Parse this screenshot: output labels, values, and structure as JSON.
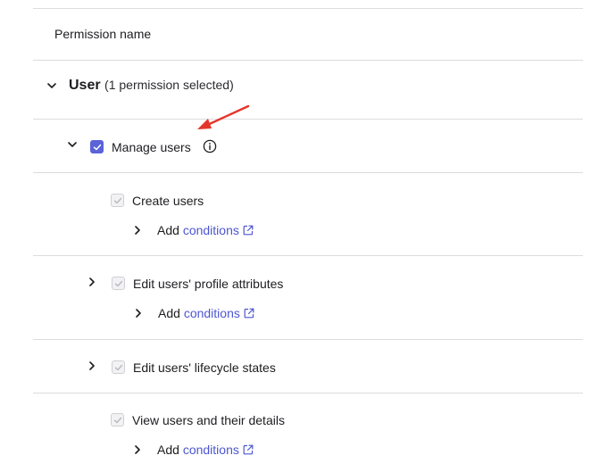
{
  "table": {
    "header": "Permission name"
  },
  "group": {
    "title": "User",
    "subtitle": "(1 permission selected)"
  },
  "parent_permission": {
    "label": "Manage users",
    "checked": true
  },
  "permissions": [
    {
      "label": "Create users",
      "add_text": "Add",
      "link_text": "conditions",
      "has_chevron": false
    },
    {
      "label": "Edit users' profile attributes",
      "add_text": "Add",
      "link_text": "conditions",
      "has_chevron": true
    },
    {
      "label": "Edit users' lifecycle states",
      "has_chevron": true
    },
    {
      "label": "View users and their details",
      "add_text": "Add",
      "link_text": "conditions",
      "has_chevron": false
    }
  ],
  "icons": {
    "chevron_down": "chevron-down-icon",
    "chevron_right": "chevron-right-icon",
    "checkmark": "checkmark-icon",
    "info": "info-icon",
    "external_link": "external-link-icon",
    "annotation_arrow": "annotation-arrow-icon"
  },
  "colors": {
    "accent": "#5a63d8",
    "link": "#4c56d0",
    "arrow": "#e5352b",
    "divider": "#dcdcdf"
  }
}
